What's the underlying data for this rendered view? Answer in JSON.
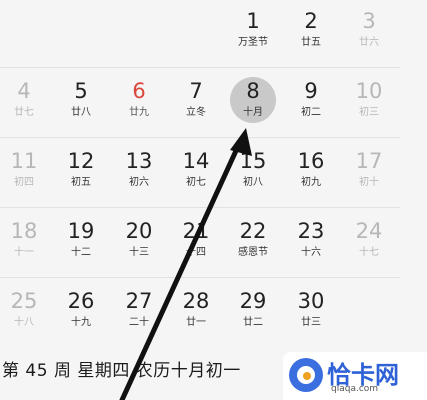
{
  "calendar": {
    "rows": [
      [
        {
          "day": "1",
          "sub": "万圣节",
          "state": "normal"
        },
        {
          "day": "2",
          "sub": "廿五",
          "state": "normal"
        },
        {
          "day": "3",
          "sub": "廿六",
          "state": "dim"
        }
      ],
      [
        {
          "day": "4",
          "sub": "廿七",
          "state": "dim"
        },
        {
          "day": "5",
          "sub": "廿八",
          "state": "normal"
        },
        {
          "day": "6",
          "sub": "廿九",
          "state": "red"
        },
        {
          "day": "7",
          "sub": "立冬",
          "state": "normal"
        },
        {
          "day": "8",
          "sub": "十月",
          "state": "today"
        },
        {
          "day": "9",
          "sub": "初二",
          "state": "normal"
        },
        {
          "day": "10",
          "sub": "初三",
          "state": "dim"
        }
      ],
      [
        {
          "day": "11",
          "sub": "初四",
          "state": "dim"
        },
        {
          "day": "12",
          "sub": "初五",
          "state": "normal"
        },
        {
          "day": "13",
          "sub": "初六",
          "state": "normal"
        },
        {
          "day": "14",
          "sub": "初七",
          "state": "normal"
        },
        {
          "day": "15",
          "sub": "初八",
          "state": "normal"
        },
        {
          "day": "16",
          "sub": "初九",
          "state": "normal"
        },
        {
          "day": "17",
          "sub": "初十",
          "state": "dim"
        }
      ],
      [
        {
          "day": "18",
          "sub": "十一",
          "state": "dim"
        },
        {
          "day": "19",
          "sub": "十二",
          "state": "normal"
        },
        {
          "day": "20",
          "sub": "十三",
          "state": "normal"
        },
        {
          "day": "21",
          "sub": "十四",
          "state": "normal"
        },
        {
          "day": "22",
          "sub": "感恩节",
          "state": "normal"
        },
        {
          "day": "23",
          "sub": "十六",
          "state": "normal"
        },
        {
          "day": "24",
          "sub": "十七",
          "state": "dim"
        }
      ],
      [
        {
          "day": "25",
          "sub": "十八",
          "state": "dim"
        },
        {
          "day": "26",
          "sub": "十九",
          "state": "normal"
        },
        {
          "day": "27",
          "sub": "二十",
          "state": "normal"
        },
        {
          "day": "28",
          "sub": "廿一",
          "state": "normal"
        },
        {
          "day": "29",
          "sub": "廿二",
          "state": "normal"
        },
        {
          "day": "30",
          "sub": "廿三",
          "state": "normal"
        }
      ]
    ]
  },
  "footer": {
    "text": "第 45 周  星期四  农历十月初一"
  },
  "watermark": {
    "title": "恰卡网",
    "url": "qiaqa.com"
  },
  "colors": {
    "red_day": "#d9473b",
    "today_circle": "#c9c9c9",
    "dim_text": "#b7b7b7",
    "brand_blue": "#2f62d6"
  }
}
